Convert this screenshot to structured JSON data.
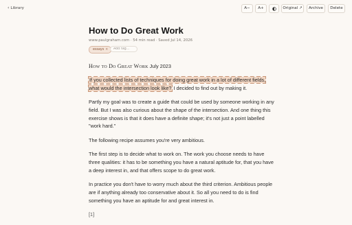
{
  "toolbar": {
    "back_label": "Library",
    "font_smaller": "A−",
    "font_larger": "A+",
    "theme_icon": "contrast-icon",
    "original_label": "Original ↗",
    "archive_label": "Archive",
    "delete_label": "Delete"
  },
  "article": {
    "title": "How to Do Great Work",
    "meta": "www.paulgraham.com · 54 min read · Saved Jul 14, 2026",
    "tags": [
      "essays"
    ],
    "tag_remove": "×",
    "tag_placeholder": "Add tag…",
    "head_title": "How to Do Great Work",
    "head_date": "July 2023",
    "highlighted_text": "If you collected lists of techniques for doing great work in a lot of different fields, what would the intersection look like?",
    "after_highlight": " I decided to find out by making it.",
    "paragraphs": [
      "Partly my goal was to create a guide that could be used by someone working in any field. But I was also curious about the shape of the intersection. And one thing this exercise shows is that it does have a definite shape; it's not just a point labelled \"work hard.\"",
      "The following recipe assumes you're very ambitious.",
      "The first step is to decide what to work on. The work you choose needs to have three qualities: it has to be something you have a natural aptitude for, that you have a deep interest in, and that offers scope to do great work.",
      "In practice you don't have to worry much about the third criterion. Ambitious people are if anything already too conservative about it. So all you need to do is find something you have an aptitude for and great interest in."
    ],
    "footnote": "[1]"
  },
  "colors": {
    "background": "#fbf8f4",
    "highlight": "#f1d6c3",
    "tag_bg": "#f4e5da"
  }
}
